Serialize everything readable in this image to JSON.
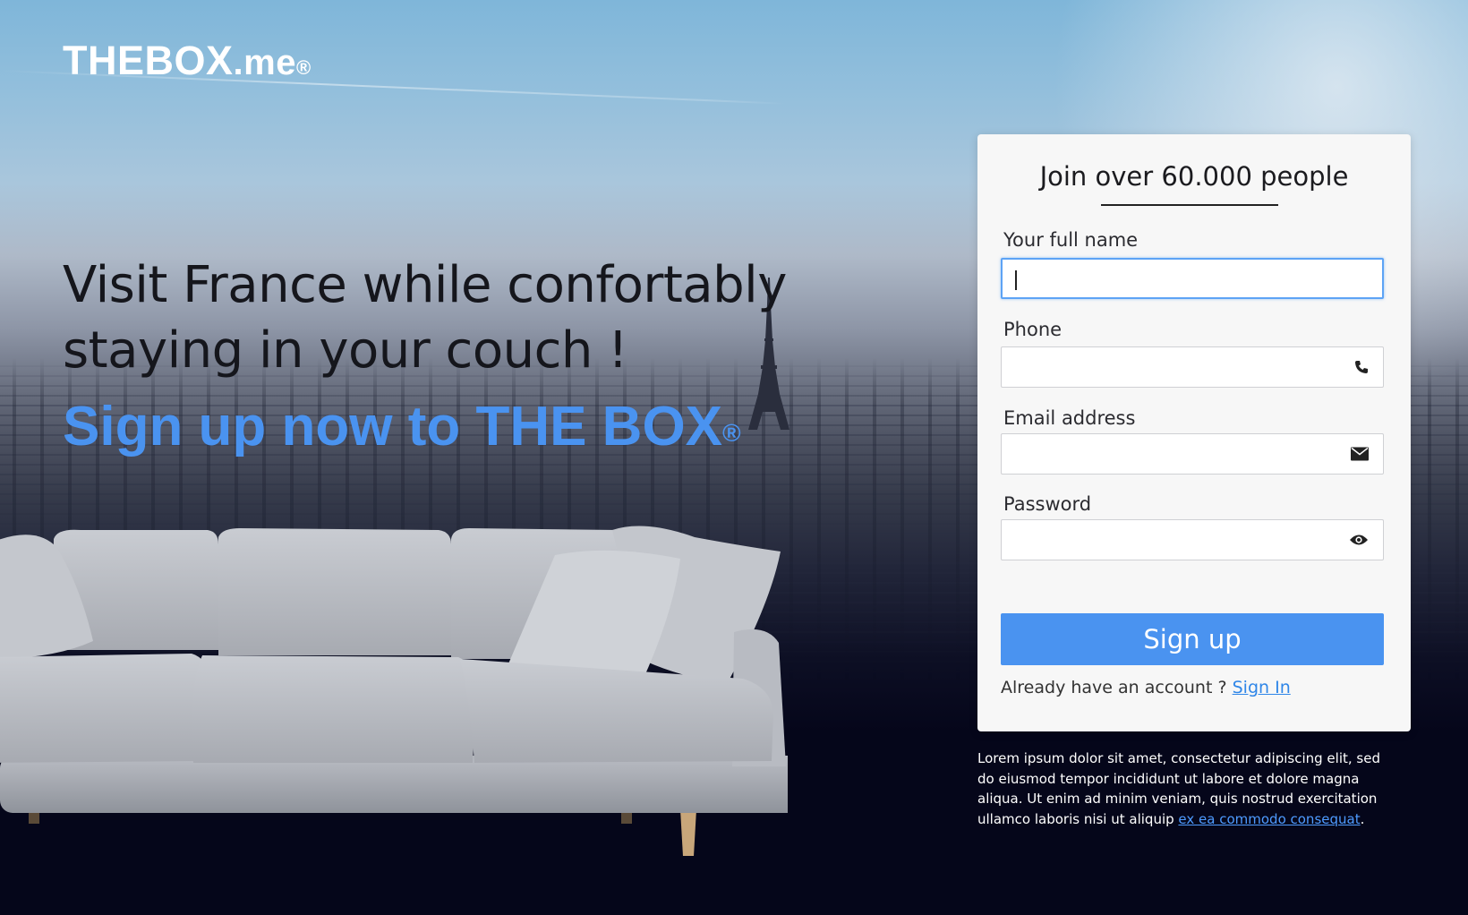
{
  "brand": {
    "logo_main": "THEBOX",
    "logo_suffix": ".me",
    "logo_reg": "®"
  },
  "hero": {
    "headline_line1": "Visit France while confortably",
    "headline_line2": "staying in your couch !",
    "cta": "Sign up now to THE BOX",
    "cta_reg": "®"
  },
  "form": {
    "title": "Join over 60.000 people",
    "fields": [
      {
        "label": "Your full name",
        "value": "",
        "icon": ""
      },
      {
        "label": "Phone",
        "value": "",
        "icon": "phone-icon"
      },
      {
        "label": "Email address",
        "value": "",
        "icon": "envelope-icon"
      },
      {
        "label": "Password",
        "value": "",
        "icon": "eye-icon"
      }
    ],
    "submit_label": "Sign up",
    "signin_prompt": "Already have an account ?",
    "signin_link": "Sign In"
  },
  "legal": {
    "text": "Lorem ipsum dolor sit amet, consectetur adipiscing elit, sed do eiusmod tempor incididunt ut labore et dolore magna aliqua. Ut enim ad minim veniam, quis nostrud exercitation ullamco laboris nisi ut aliquip",
    "link": "ex ea commodo consequat",
    "end": "."
  },
  "colors": {
    "accent": "#4a93f0",
    "background_dark": "#05061a",
    "card": "#f7f7f7"
  }
}
